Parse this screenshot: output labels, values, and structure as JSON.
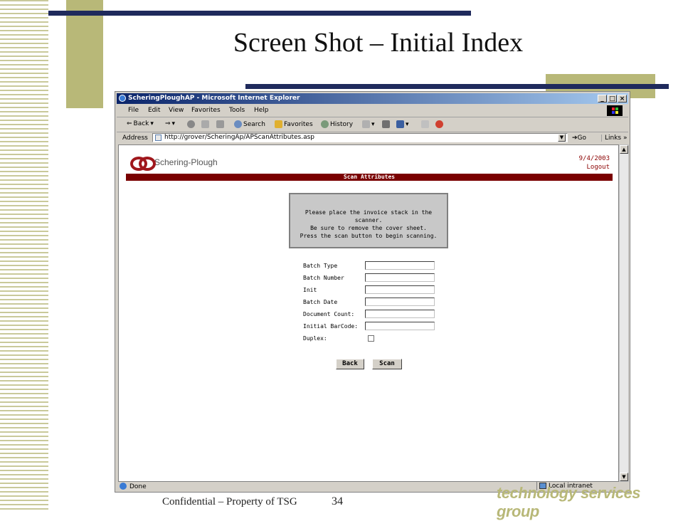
{
  "slide": {
    "title": "Screen Shot – Initial Index",
    "footer_left": "Confidential – Property of TSG",
    "page_number": "34",
    "brand": "technology services group"
  },
  "window": {
    "title": "ScheringPloughAP - Microsoft Internet Explorer",
    "controls": {
      "minimize": "_",
      "maximize": "□",
      "close": "×"
    },
    "menu": [
      "File",
      "Edit",
      "View",
      "Favorites",
      "Tools",
      "Help"
    ],
    "toolbar": {
      "back": "Back",
      "forward": "⇒",
      "search": "Search",
      "favorites": "Favorites",
      "history": "History"
    },
    "address": {
      "label": "Address",
      "url": "http://grover/ScheringAp/APScanAttributes.asp",
      "go": "Go",
      "links": "Links"
    },
    "status": {
      "text": "Done",
      "zone": "Local intranet"
    }
  },
  "page": {
    "logo_text": "Schering-Plough",
    "date": "9/4/2003",
    "logout": "Logout",
    "section_title": "Scan Attributes",
    "message": [
      "Please place the invoice stack in the scanner.",
      "Be sure to remove the cover sheet.",
      "Press the scan button to begin scanning."
    ],
    "fields": {
      "batch_type": {
        "label": "Batch Type",
        "value": ""
      },
      "batch_number": {
        "label": "Batch Number",
        "value": ""
      },
      "init": {
        "label": "Init",
        "value": ""
      },
      "batch_date": {
        "label": "Batch Date",
        "value": ""
      },
      "document_count": {
        "label": "Document Count:",
        "value": ""
      },
      "initial_barcode": {
        "label": "Initial BarCode:",
        "value": ""
      },
      "duplex": {
        "label": "Duplex:",
        "checked": false
      }
    },
    "buttons": {
      "back": "Back",
      "scan": "Scan"
    }
  },
  "colors": {
    "brand_red": "#7a0000",
    "slide_navy": "#1f2a5c",
    "slide_olive": "#b8b878"
  }
}
